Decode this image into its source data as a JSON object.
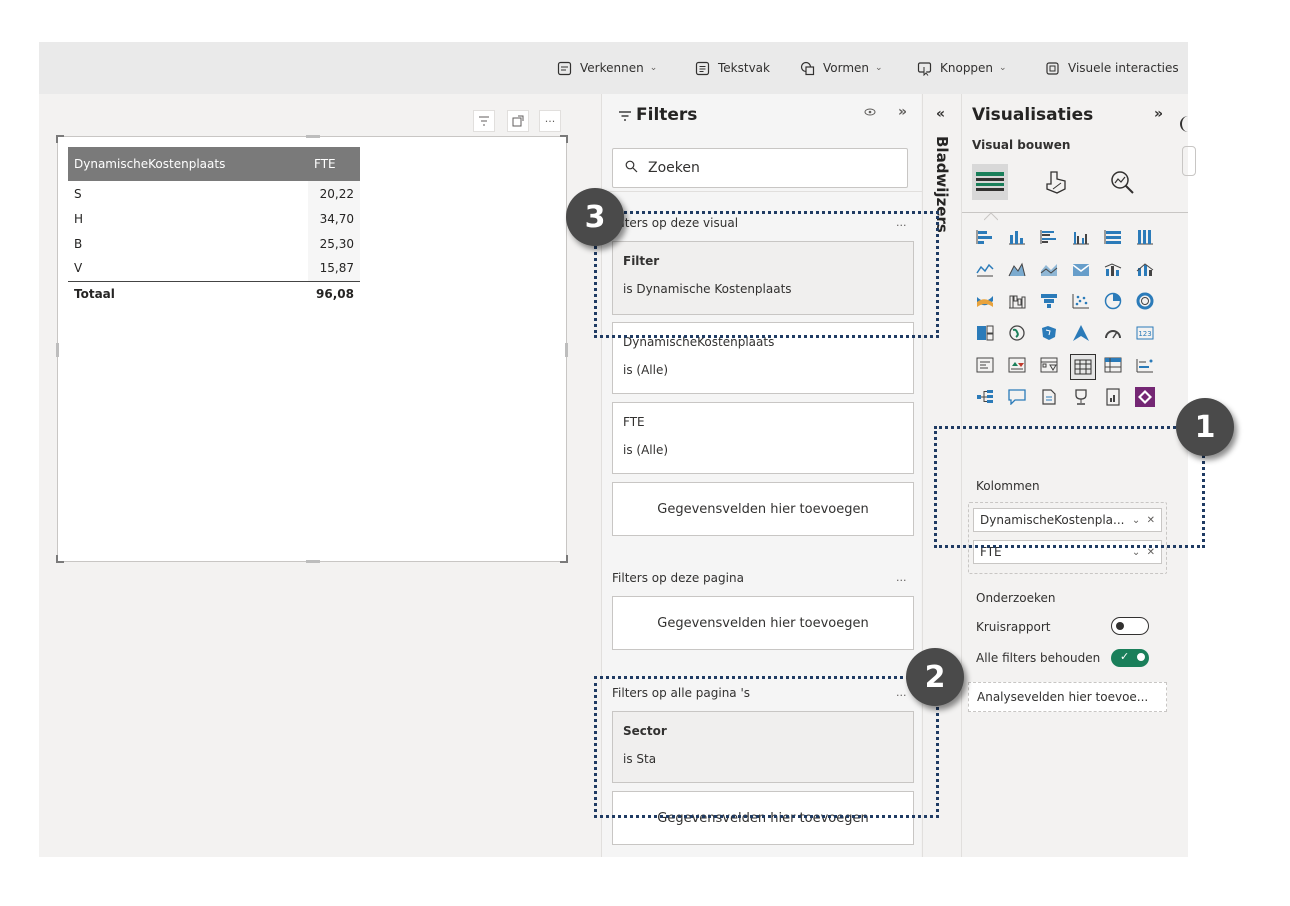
{
  "ribbon": {
    "explore": "Verkennen",
    "textbox": "Tekstvak",
    "shapes": "Vormen",
    "buttons": "Knoppen",
    "visual_interactions": "Visuele interacties"
  },
  "table_visual": {
    "headers": [
      "DynamischeKostenplaats",
      "FTE"
    ],
    "rows": [
      {
        "label": "S",
        "value": "20,22"
      },
      {
        "label": "H",
        "value": "34,70"
      },
      {
        "label": "B",
        "value": "25,30"
      },
      {
        "label": "V",
        "value": "15,87"
      }
    ],
    "total": {
      "label": "Totaal",
      "value": "96,08"
    }
  },
  "filters": {
    "title": "Filters",
    "search_placeholder": "Zoeken",
    "visual_section": "Filters op deze visual",
    "cards_visual": [
      {
        "title": "Filter",
        "value": "is Dynamische Kostenplaats"
      },
      {
        "title": "DynamischeKostenplaats",
        "value": "is (Alle)"
      },
      {
        "title": "FTE",
        "value": "is (Alle)"
      }
    ],
    "add_fields": "Gegevensvelden hier toevoegen",
    "page_section": "Filters op deze pagina",
    "all_pages_section": "Filters op alle pagina 's",
    "cards_all": [
      {
        "title": "Sector",
        "value": "is Sta"
      }
    ],
    "more": "..."
  },
  "bookmarks": {
    "label": "Bladwijzers",
    "collapse": "«"
  },
  "visualisations": {
    "title": "Visualisaties",
    "expand": "»",
    "build_label": "Visual bouwen",
    "columns_label": "Kolommen",
    "fields": [
      "DynamischeKostenpla...",
      "FTE"
    ],
    "explore_label": "Onderzoeken",
    "cross_report": "Kruisrapport",
    "keep_filters": "Alle filters behouden",
    "analysis_fields": "Analysevelden hier toevoe..."
  },
  "badges": [
    "1",
    "2",
    "3"
  ],
  "colors": {
    "accent_dark": "#1f3b63",
    "toggle_on": "#1a7f5a",
    "header_gray": "#7a7a7a",
    "badge": "#4a4a4a"
  }
}
